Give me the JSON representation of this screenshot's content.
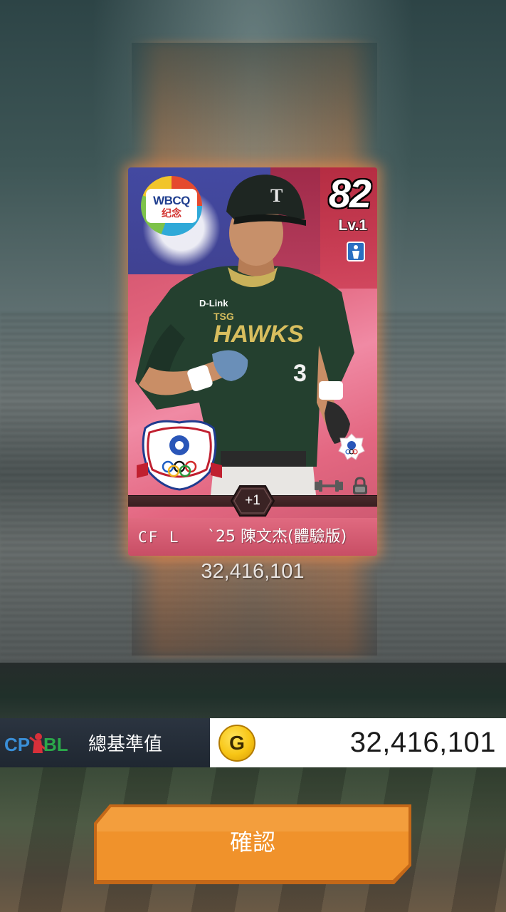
{
  "card": {
    "rating": "82",
    "level": "Lv.1",
    "badge_text": "WBCQ",
    "badge_subtext": "纪念",
    "plus": "+1",
    "position": "CF L",
    "name": "`25 陳文杰(體驗版)",
    "jersey_text": "HAWKS",
    "jersey_number": "3",
    "sponsor": "D-Link",
    "value": "32,416,101",
    "glow_color": "#ff8c46",
    "card_color": "#e1637c"
  },
  "total": {
    "logo_text_cp": "CP",
    "logo_text_bl": "BL",
    "label": "總基準值",
    "currency_icon": "gold-coin-icon",
    "currency_letter": "G",
    "value": "32,416,101"
  },
  "confirm": {
    "label": "確認",
    "color": "#f0922b"
  }
}
